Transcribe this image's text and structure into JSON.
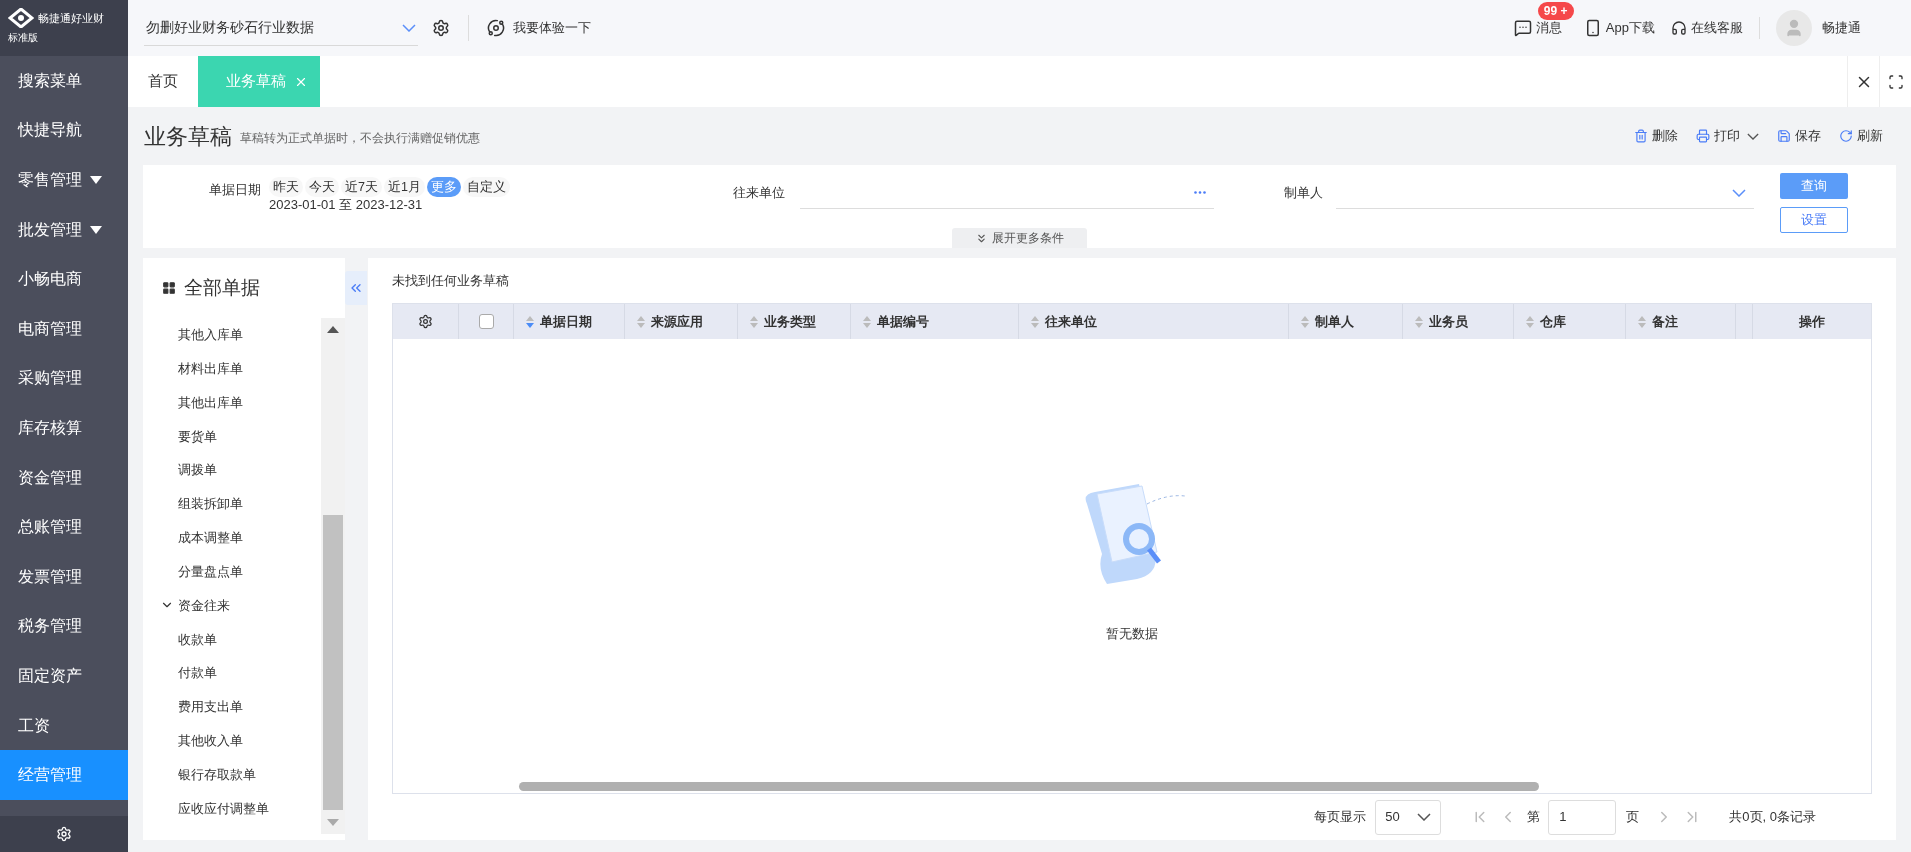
{
  "brand": {
    "name": "畅捷通好业财",
    "edition": "标准版"
  },
  "topbar": {
    "account": "勿删好业财务砂石行业数据",
    "trial": "我要体验一下",
    "message_badge": "99 +",
    "messages": "消息",
    "app_download": "App下载",
    "support": "在线客服",
    "user": "畅捷通"
  },
  "sidebar": {
    "items": [
      {
        "label": "搜索菜单",
        "selected": false,
        "expandable": false
      },
      {
        "label": "快捷导航",
        "selected": false,
        "expandable": false
      },
      {
        "label": "零售管理",
        "selected": false,
        "expandable": true
      },
      {
        "label": "批发管理",
        "selected": false,
        "expandable": true
      },
      {
        "label": "小畅电商",
        "selected": false,
        "expandable": false
      },
      {
        "label": "电商管理",
        "selected": false,
        "expandable": false
      },
      {
        "label": "采购管理",
        "selected": false,
        "expandable": false
      },
      {
        "label": "库存核算",
        "selected": false,
        "expandable": false
      },
      {
        "label": "资金管理",
        "selected": false,
        "expandable": false
      },
      {
        "label": "总账管理",
        "selected": false,
        "expandable": false
      },
      {
        "label": "发票管理",
        "selected": false,
        "expandable": false
      },
      {
        "label": "税务管理",
        "selected": false,
        "expandable": false
      },
      {
        "label": "固定资产",
        "selected": false,
        "expandable": false
      },
      {
        "label": "工资",
        "selected": false,
        "expandable": false
      },
      {
        "label": "经营管理",
        "selected": true,
        "expandable": false
      }
    ]
  },
  "tabs": [
    {
      "label": "首页",
      "selected": false,
      "closable": false
    },
    {
      "label": "业务草稿",
      "selected": true,
      "closable": true
    }
  ],
  "page": {
    "title": "业务草稿",
    "subtitle": "草稿转为正式单据时，不会执行满赠促销优惠",
    "actions": [
      {
        "label": "删除",
        "dropdown": false
      },
      {
        "label": "打印",
        "dropdown": true
      },
      {
        "label": "保存",
        "dropdown": false
      },
      {
        "label": "刷新",
        "dropdown": false
      }
    ]
  },
  "filters": {
    "date_label": "单据日期",
    "date_chips": [
      {
        "label": "昨天",
        "selected": false
      },
      {
        "label": "今天",
        "selected": false
      },
      {
        "label": "近7天",
        "selected": false
      },
      {
        "label": "近1月",
        "selected": false
      },
      {
        "label": "更多",
        "selected": true
      },
      {
        "label": "自定义",
        "selected": false
      }
    ],
    "date_range": "2023-01-01 至 2023-12-31",
    "partner_label": "往来单位",
    "creator_label": "制单人",
    "more_conditions": "展开更多条件",
    "buttons": [
      {
        "label": "查询",
        "kind": "primary"
      },
      {
        "label": "设置",
        "kind": "secondary"
      }
    ]
  },
  "tree": {
    "title": "全部单据",
    "nodes": [
      {
        "children": [
          {
            "label": "其他入库单"
          },
          {
            "label": "材料出库单"
          },
          {
            "label": "其他出库单"
          },
          {
            "label": "要货单"
          },
          {
            "label": "调拨单"
          },
          {
            "label": "组装拆卸单"
          },
          {
            "label": "成本调整单"
          },
          {
            "label": "分量盘点单"
          }
        ]
      },
      {
        "label": "资金往来",
        "expanded": true,
        "children": [
          {
            "label": "收款单"
          },
          {
            "label": "付款单"
          },
          {
            "label": "费用支出单"
          },
          {
            "label": "其他收入单"
          },
          {
            "label": "银行存取款单"
          },
          {
            "label": "应收应付调整单"
          }
        ]
      }
    ]
  },
  "table": {
    "notice": "未找到任何业务草稿",
    "columns": [
      {
        "label": "单据日期",
        "sorted": true
      },
      {
        "label": "来源应用",
        "sorted": false
      },
      {
        "label": "业务类型",
        "sorted": false
      },
      {
        "label": "单据编号",
        "sorted": false
      },
      {
        "label": "往来单位",
        "sorted": false
      },
      {
        "label": "制单人",
        "sorted": false
      },
      {
        "label": "业务员",
        "sorted": false
      },
      {
        "label": "仓库",
        "sorted": false
      },
      {
        "label": "备注",
        "sorted": false
      }
    ],
    "select_all": {
      "checked": false
    },
    "actions_column": "操作",
    "empty_text": "暂无数据"
  },
  "pagination": {
    "page_size_label": "每页显示",
    "page_size": "50",
    "page_prefix": "第",
    "page": "1",
    "page_suffix": "页",
    "summary": "共0页, 0条记录"
  }
}
